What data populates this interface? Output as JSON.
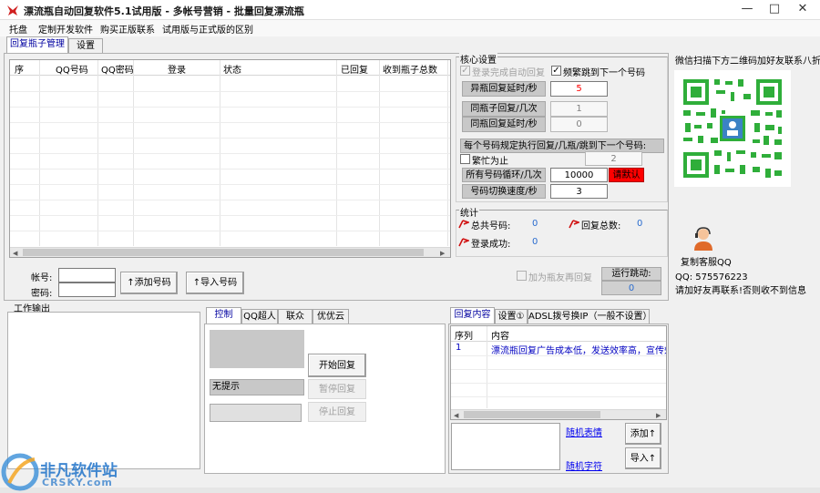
{
  "window": {
    "title": "漂流瓶自动回复软件5.1试用版 - 多帐号营销 - 批量回复漂流瓶",
    "minimize": "—",
    "maximize": "□",
    "close": "✕"
  },
  "menu": [
    "托盘",
    "定制开发软件",
    "购买正版联系",
    "试用版与正式版的区别"
  ],
  "top_tabs": [
    "回复瓶子管理",
    "设置"
  ],
  "grid": {
    "columns": [
      "序",
      "QQ号码",
      "QQ密码",
      "登录",
      "状态",
      "已回复",
      "收到瓶子总数"
    ]
  },
  "account": {
    "account_label": "帐号:",
    "password_label": "密码:",
    "add_button": "↑添加号码",
    "import_button": "↑导入号码",
    "add_friend_reply": "加为瓶友再回复",
    "run_jump_label": "运行跳动:",
    "run_jump_value": "0"
  },
  "core": {
    "title": "核心设置",
    "auto_reply_after_login": "登录完成自动回复",
    "busy_jump_next": "频繁跳到下一个号码",
    "abnormal_delay_label": "异瓶回复延时/秒",
    "abnormal_delay_value": "5",
    "same_bottle_reply_label": "同瓶子回复/几次",
    "same_bottle_reply_value": "1",
    "same_bottle_delay_label": "同瓶回复延时/秒",
    "same_bottle_delay_value": "0",
    "rule_text": "每个号码规定执行回复/几瓶/跳到下一个号码:",
    "busy_stop_label": "繁忙为止",
    "busy_stop_value": "2",
    "all_loop_label": "所有号码循环/几次",
    "all_loop_value": "10000",
    "default_button": "请默认",
    "switch_speed_label": "号码切换速度/秒",
    "switch_speed_value": "3"
  },
  "stats": {
    "title": "统计",
    "total_label": "总共号码:",
    "total_value": "0",
    "reply_total_label": "回复总数:",
    "reply_total_value": "0",
    "login_success_label": "登录成功:",
    "login_success_value": "0"
  },
  "qr": {
    "caption": "微信扫描下方二维码加好友联系八折",
    "service_label": "复制客服QQ",
    "qq_line": "QQ: 575576223",
    "note": "请加好友再联系!否则收不到信息"
  },
  "output": {
    "title": "工作输出"
  },
  "control_tabs": [
    "控制",
    "QQ超人",
    "联众",
    "优优云"
  ],
  "control": {
    "no_prompt": "无提示",
    "start": "开始回复",
    "pause": "暂停回复",
    "stop": "停止回复"
  },
  "reply_tabs": [
    "回复内容",
    "设置①",
    "ADSL拨号换IP（一般不设置）"
  ],
  "reply_grid": {
    "columns": [
      "序列",
      "内容"
    ],
    "rows": [
      {
        "index": "1",
        "content": "漂流瓶回复广告成本低，发送效率高，宣传效"
      }
    ]
  },
  "reply_tools": {
    "random_emoji": "随机表情",
    "random_char": "随机字符",
    "add": "添加↑",
    "import": "导入↑"
  },
  "watermark": {
    "cn": "非凡软件站",
    "en": "CRSKY.com"
  },
  "colors": {
    "accent": "#0000a0",
    "red_value": "#ff0000",
    "stat_value": "#2a6ccf",
    "reply_text": "#0000c0"
  }
}
